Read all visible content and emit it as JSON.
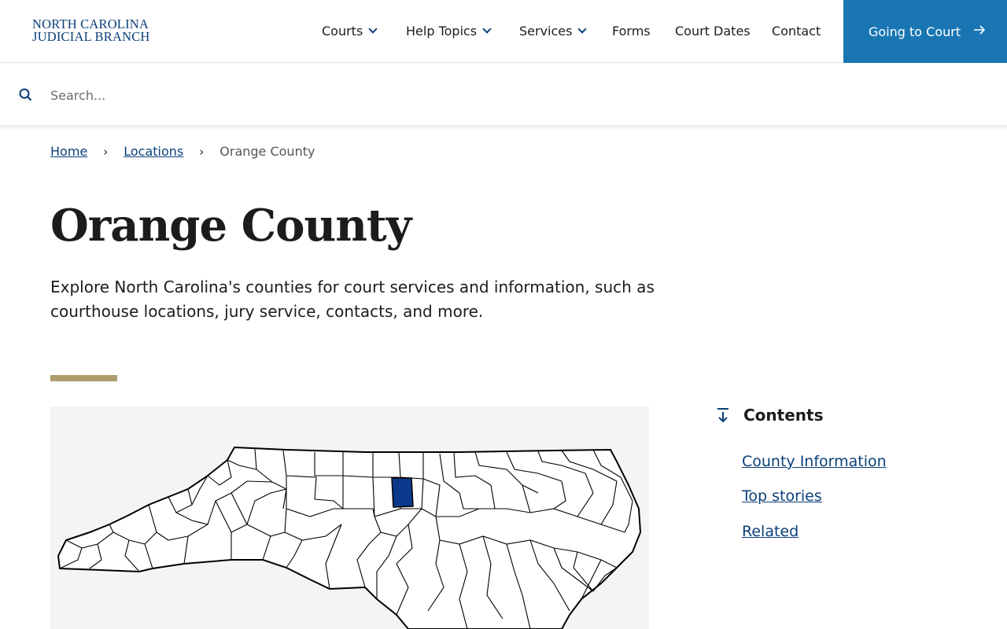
{
  "header": {
    "logo_line1": "NORTH CAROLINA",
    "logo_line2": "JUDICIAL BRANCH",
    "nav": [
      {
        "label": "Courts",
        "has_dropdown": true
      },
      {
        "label": "Help Topics",
        "has_dropdown": true
      },
      {
        "label": "Services",
        "has_dropdown": true
      },
      {
        "label": "Forms",
        "has_dropdown": false
      },
      {
        "label": "Court Dates",
        "has_dropdown": false
      },
      {
        "label": "Contact",
        "has_dropdown": false
      }
    ],
    "cta_label": "Going to Court",
    "cta_icon": "arrow-right-icon"
  },
  "search": {
    "placeholder": "Search...",
    "value": "",
    "icon": "search-icon"
  },
  "breadcrumb": {
    "items": [
      "Home",
      "Locations"
    ],
    "current": "Orange County"
  },
  "page": {
    "title": "Orange County",
    "lead": "Explore North Carolina's counties for court services and information, such as courthouse locations, jury service, contacts, and more."
  },
  "map": {
    "description_icon": "nc-county-map",
    "highlight_color": "#0b3a8c"
  },
  "contents": {
    "heading": "Contents",
    "icon": "arrow-down-to-line-icon",
    "links": [
      "County Information",
      "Top stories",
      "Related"
    ]
  },
  "colors": {
    "brand_navy": "#0b3f7a",
    "cta_blue": "#1a76b3",
    "accent_gold": "#ae9b6e"
  }
}
